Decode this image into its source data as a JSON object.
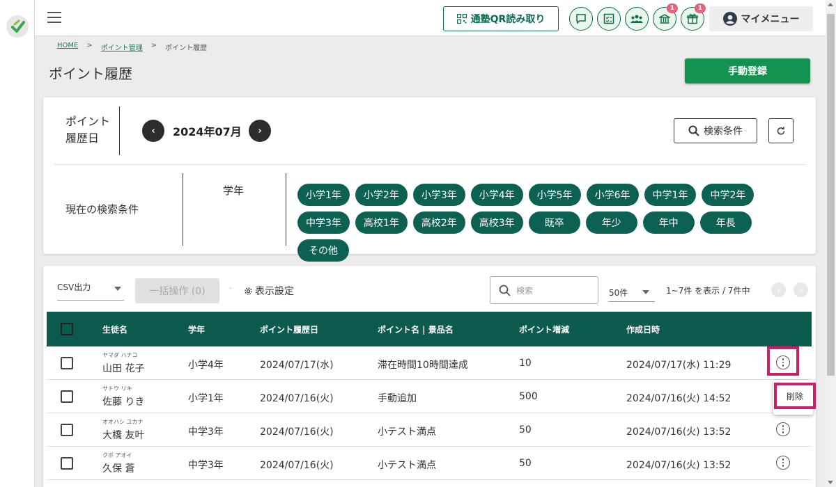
{
  "header": {
    "qr_button": "通塾QR読み取り",
    "icons": [
      {
        "name": "chat-icon",
        "badge": ""
      },
      {
        "name": "checklist-icon",
        "badge": ""
      },
      {
        "name": "group-icon",
        "badge": ""
      },
      {
        "name": "school-icon",
        "badge": "1"
      },
      {
        "name": "gift-icon",
        "badge": "1"
      }
    ],
    "my_menu": "マイメニュー"
  },
  "breadcrumb": {
    "home": "HOME",
    "sep": ">",
    "point_mgmt": "ポイント管理",
    "current": "ポイント履歴"
  },
  "page": {
    "title": "ポイント履歴",
    "manual_button": "手動登録"
  },
  "filter": {
    "date_label_1": "ポイント",
    "date_label_2": "履歴日",
    "month": "2024年07月",
    "search_button": "検索条件",
    "current_conditions": "現在の検索条件",
    "grade_label": "学年",
    "grades": [
      "小学1年",
      "小学2年",
      "小学3年",
      "小学4年",
      "小学5年",
      "小学6年",
      "中学1年",
      "中学2年",
      "中学3年",
      "高校1年",
      "高校2年",
      "高校3年",
      "既卒",
      "年少",
      "年中",
      "年長",
      "その他"
    ]
  },
  "toolbar": {
    "csv": "CSV出力",
    "bulk": "一括操作 (0)",
    "display_settings": "表示設定",
    "search_placeholder": "検索",
    "per_page": "50件",
    "range": "1~7件 を表示 / 7件中"
  },
  "table": {
    "headers": [
      "生徒名",
      "学年",
      "ポイント履歴日",
      "ポイント名 | 景品名",
      "ポイント増減",
      "作成日時"
    ],
    "rows": [
      {
        "kana": "ヤマダ ハナコ",
        "name": "山田 花子",
        "grade": "小学4年",
        "date": "2024/07/17(水)",
        "point_name": "滞在時間10時間達成",
        "points": "10",
        "created": "2024/07/17(水) 11:29"
      },
      {
        "kana": "サトウ リキ",
        "name": "佐藤 りき",
        "grade": "小学1年",
        "date": "2024/07/16(火)",
        "point_name": "手動追加",
        "points": "500",
        "created": "2024/07/16(火) 14:52"
      },
      {
        "kana": "オオハシ ユカナ",
        "name": "大橋 友叶",
        "grade": "中学3年",
        "date": "2024/07/16(火)",
        "point_name": "小テスト満点",
        "points": "50",
        "created": "2024/07/16(火) 13:52"
      },
      {
        "kana": "クボ アオイ",
        "name": "久保 蒼",
        "grade": "中学3年",
        "date": "2024/07/16(火)",
        "point_name": "小テスト満点",
        "points": "50",
        "created": "2024/07/16(火) 13:52"
      }
    ]
  },
  "popup": {
    "delete": "削除"
  },
  "colors": {
    "primary": "#0d5a4f",
    "accent_green": "#14924f",
    "highlight": "#cc1f6a",
    "badge": "#e0657e"
  }
}
